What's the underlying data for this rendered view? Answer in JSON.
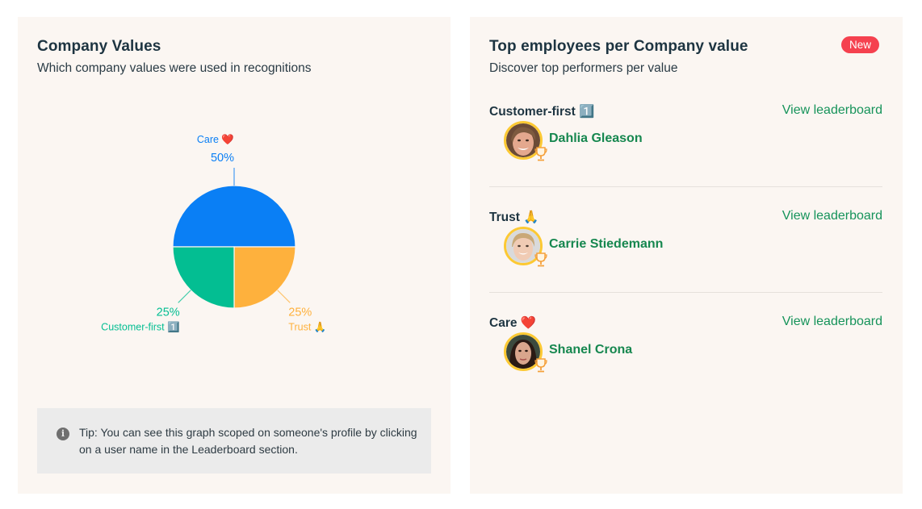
{
  "left_card": {
    "title": "Company Values",
    "subtitle": "Which company values were used in recognitions",
    "tip": {
      "icon": "info-icon",
      "text": "Tip: You can see this graph scoped on someone's profile by clicking on a user name in the Leaderboard section."
    }
  },
  "chart_data": {
    "type": "pie",
    "title": "Company Values",
    "slices": [
      {
        "label": "Care ❤️",
        "value": 50,
        "display": "50%",
        "color": "#0a7ff5"
      },
      {
        "label": "Trust 🙏",
        "value": 25,
        "display": "25%",
        "color": "#feb13d"
      },
      {
        "label": "Customer-first 1️⃣",
        "value": 25,
        "display": "25%",
        "color": "#03be92"
      }
    ],
    "legend": "none",
    "label_placement": "outside-with-leader-lines"
  },
  "right_card": {
    "title": "Top employees per Company value",
    "badge": "New",
    "subtitle": "Discover top performers per value",
    "sections": [
      {
        "value": "Customer-first",
        "emoji": "1️⃣",
        "link": "View leaderboard",
        "employee": {
          "name": "Dahlia Gleason",
          "avatar": "avatar-photo",
          "award": "trophy-icon"
        }
      },
      {
        "value": "Trust",
        "emoji": "🙏",
        "link": "View leaderboard",
        "employee": {
          "name": "Carrie Stiedemann",
          "avatar": "avatar-photo",
          "award": "trophy-icon"
        }
      },
      {
        "value": "Care",
        "emoji": "❤️",
        "link": "View leaderboard",
        "employee": {
          "name": "Shanel Crona",
          "avatar": "avatar-photo",
          "award": "trophy-icon"
        }
      }
    ]
  },
  "colors": {
    "card_bg": "#fbf6f2",
    "heading": "#1d3441",
    "link_green": "#16935a",
    "badge_red": "#f5414f",
    "avatar_ring": "#fcc933",
    "trophy": "#f5a03a"
  }
}
